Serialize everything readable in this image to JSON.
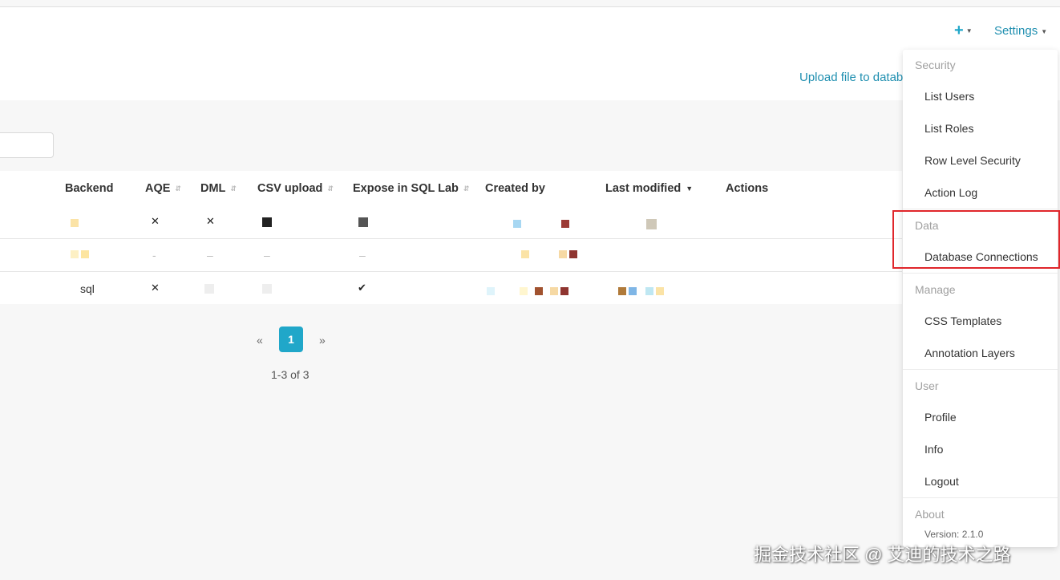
{
  "navbar": {
    "plus_label": "+",
    "settings_label": "Settings"
  },
  "subheader": {
    "upload_link": "Upload file to datab"
  },
  "table": {
    "columns": [
      "Backend",
      "AQE",
      "DML",
      "CSV upload",
      "Expose in SQL Lab",
      "Created by",
      "Last modified",
      "Actions"
    ],
    "rows": [
      {
        "backend": "",
        "aqe": "✕",
        "dml": "✕",
        "csv_upload": "",
        "expose": "",
        "created_by": "",
        "last_modified": ""
      },
      {
        "backend": "",
        "aqe": "",
        "dml": "",
        "csv_upload": "",
        "expose": "",
        "created_by": "",
        "last_modified": ""
      },
      {
        "backend": "sql",
        "aqe": "✕",
        "dml": "",
        "csv_upload": "",
        "expose": "✔",
        "created_by": "",
        "last_modified": ""
      }
    ]
  },
  "pagination": {
    "prev": "«",
    "current": "1",
    "next": "»",
    "range": "1-3 of 3"
  },
  "dropdown": {
    "groups": [
      {
        "title": "Security",
        "items": [
          "List Users",
          "List Roles",
          "Row Level Security",
          "Action Log"
        ]
      },
      {
        "title": "Data",
        "items": [
          "Database Connections"
        ]
      },
      {
        "title": "Manage",
        "items": [
          "CSS Templates",
          "Annotation Layers"
        ]
      },
      {
        "title": "User",
        "items": [
          "Profile",
          "Info",
          "Logout"
        ]
      },
      {
        "title": "About",
        "items": []
      }
    ],
    "version": "Version: 2.1.0"
  },
  "watermark": "掘金技术社区 @ 艾迪的技术之路",
  "colors": {
    "accent": "#20a7c9",
    "link": "#1f8fb0",
    "highlight": "#e0262b"
  }
}
